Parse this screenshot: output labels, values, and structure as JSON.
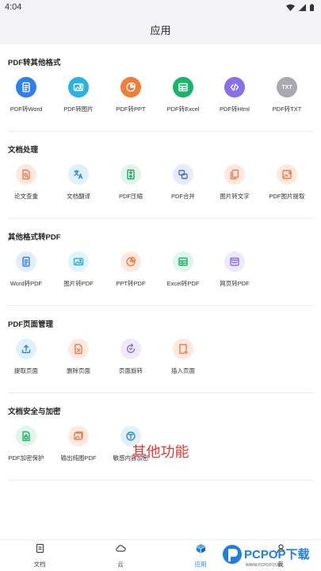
{
  "status_bar": {
    "time": "4:04"
  },
  "header": {
    "title": "应用"
  },
  "sections": [
    {
      "title": "PDF转其他格式",
      "items": [
        {
          "label": "PDF转Word",
          "icon": "doc-icon",
          "bg": "#2f7ef2"
        },
        {
          "label": "PDF转图片",
          "icon": "image-icon",
          "bg": "#2cb2e0"
        },
        {
          "label": "PDF转PPT",
          "icon": "pie-chart-icon",
          "bg": "#f07d3a"
        },
        {
          "label": "PDF转Excel",
          "icon": "table-icon",
          "bg": "#19b46c"
        },
        {
          "label": "PDF转Html",
          "icon": "code-icon",
          "bg": "#8a6fe8"
        },
        {
          "label": "PDF转TXT",
          "icon": "txt-icon",
          "bg": "#a9a9b3",
          "text": "TXT"
        }
      ]
    },
    {
      "title": "文档处理",
      "items": [
        {
          "label": "论文查重",
          "icon": "doc-search-icon",
          "bg": "#fde9df",
          "fg": "#ef7b4b"
        },
        {
          "label": "文档翻译",
          "icon": "translate-icon",
          "bg": "#e1f0fb",
          "fg": "#2e8dd6"
        },
        {
          "label": "PDF压缩",
          "icon": "compress-icon",
          "bg": "#e1f5ea",
          "fg": "#23a862"
        },
        {
          "label": "PDF合并",
          "icon": "merge-icon",
          "bg": "#e6ecfb",
          "fg": "#4a6fd8"
        },
        {
          "label": "图片转文字",
          "icon": "copy-icon",
          "bg": "#fde9df",
          "fg": "#ef7b4b"
        },
        {
          "label": "PDF图片提取",
          "icon": "image-extract-icon",
          "bg": "#fde9df",
          "fg": "#ef7b4b"
        }
      ]
    },
    {
      "title": "其他格式转PDF",
      "items": [
        {
          "label": "Word转PDF",
          "icon": "doc-icon",
          "bg": "#e6ecfb",
          "fg": "#2f7ef2"
        },
        {
          "label": "图片转PDF",
          "icon": "image-icon",
          "bg": "#e0f4fb",
          "fg": "#2cb2e0"
        },
        {
          "label": "PPT转PDF",
          "icon": "pie-chart-icon",
          "bg": "#fde9df",
          "fg": "#f07d3a"
        },
        {
          "label": "Excel转PDF",
          "icon": "table-icon",
          "bg": "#e1f5ea",
          "fg": "#19b46c"
        },
        {
          "label": "网页转PDF",
          "icon": "web-icon",
          "bg": "#efe9fb",
          "fg": "#8a6fe8"
        }
      ]
    },
    {
      "title": "PDF页面管理",
      "items": [
        {
          "label": "提取页面",
          "icon": "upload-icon",
          "bg": "#e1f0fb",
          "fg": "#2e8dd6"
        },
        {
          "label": "删除页面",
          "icon": "delete-page-icon",
          "bg": "#fde9df",
          "fg": "#ef7b4b"
        },
        {
          "label": "页面旋转",
          "icon": "rotate-icon",
          "bg": "#efe9fb",
          "fg": "#8a6fe8"
        },
        {
          "label": "插入页面",
          "icon": "insert-page-icon",
          "bg": "#fde9df",
          "fg": "#ef7b4b"
        }
      ]
    },
    {
      "title": "文档安全与加密",
      "items": [
        {
          "label": "PDF加密保护",
          "icon": "lock-doc-icon",
          "bg": "#e1f5ea",
          "fg": "#19b46c"
        },
        {
          "label": "输出纯图PDF",
          "icon": "image-pdf-icon",
          "bg": "#fde9df",
          "fg": "#ef7b4b"
        },
        {
          "label": "敏感内容加密",
          "icon": "text-shield-icon",
          "bg": "#e1f0fb",
          "fg": "#2e8dd6"
        }
      ]
    }
  ],
  "extra_label": "其他功能",
  "tabs": [
    {
      "label": "文档",
      "icon": "document-tab-icon",
      "active": false
    },
    {
      "label": "云",
      "icon": "cloud-tab-icon",
      "active": false
    },
    {
      "label": "应用",
      "icon": "apps-cube-icon",
      "active": true
    },
    {
      "label": "我",
      "icon": "profile-tab-icon",
      "active": false
    }
  ],
  "watermark": {
    "text": "PCPOP下载",
    "sub": "WWW.PCPOP.COM"
  },
  "colors": {
    "accent": "#1e88e5",
    "extra": "#e53935"
  }
}
